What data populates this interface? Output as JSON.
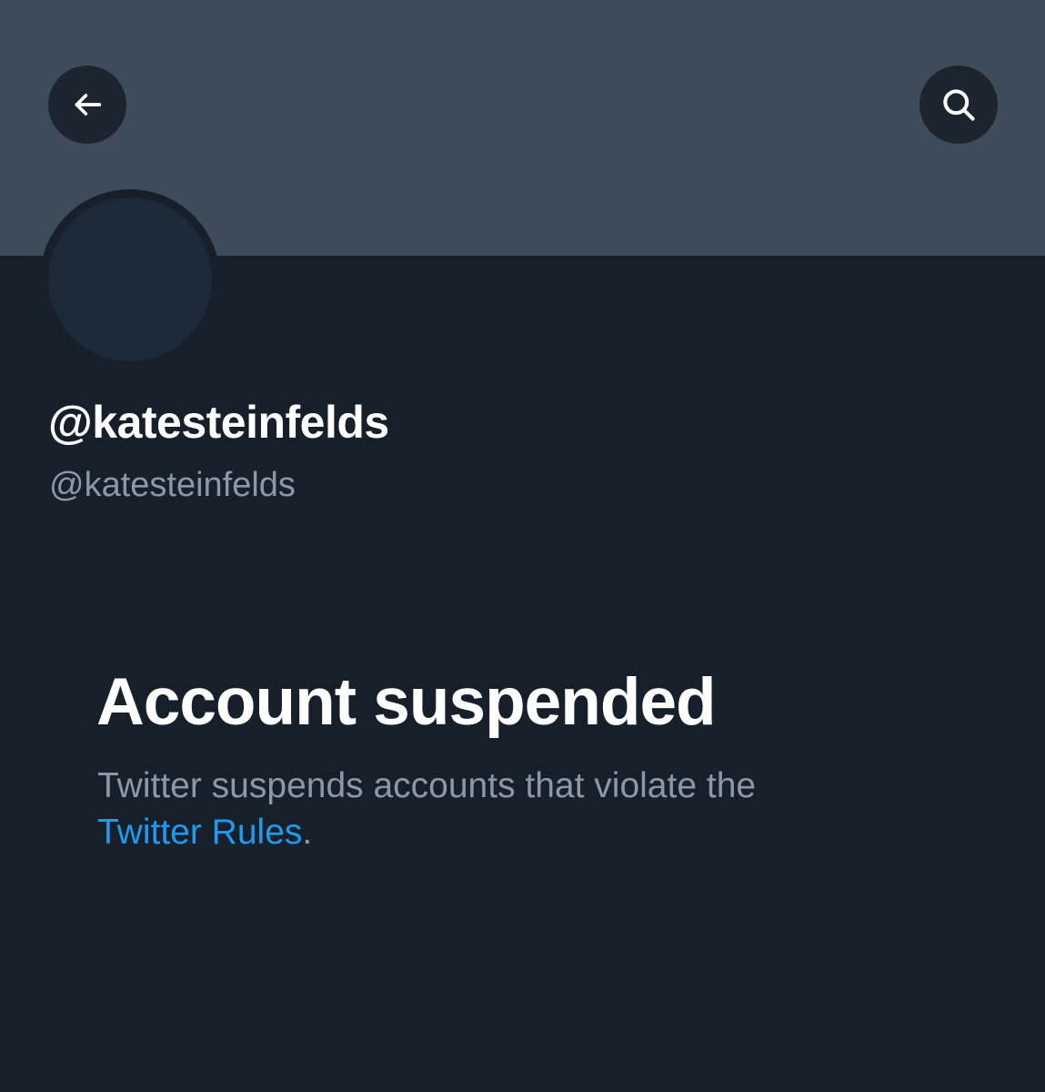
{
  "header": {
    "back_icon": "arrow-left-icon",
    "search_icon": "search-icon"
  },
  "profile": {
    "display_name": "@katesteinfelds",
    "handle": "@katesteinfelds"
  },
  "notice": {
    "title": "Account suspended",
    "description": "Twitter suspends accounts that violate the",
    "link_text": "Twitter Rules",
    "trailing": "."
  },
  "colors": {
    "background": "#17202a",
    "banner": "#3d4b5a",
    "link": "#1d9bf0",
    "secondary_text": "#8b98a5"
  }
}
